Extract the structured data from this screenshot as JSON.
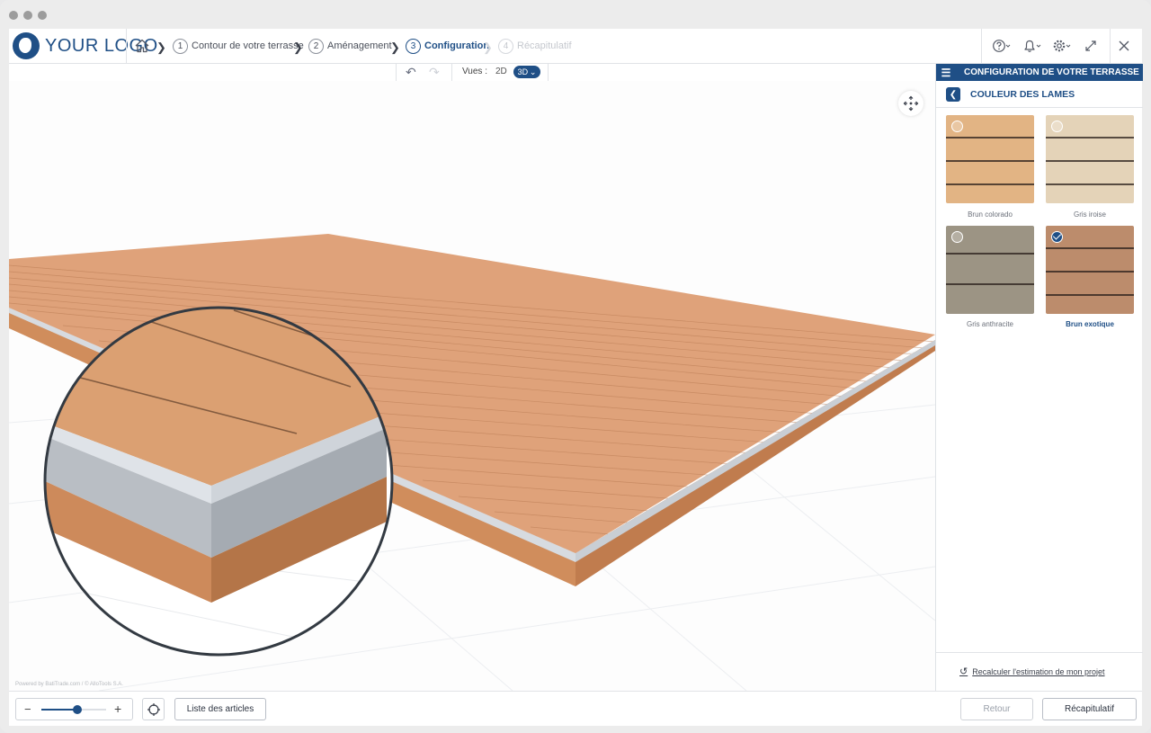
{
  "header": {
    "logo_text": "YOUR LOGO",
    "steps": [
      {
        "num": "1",
        "label": "Contour de votre terrasse",
        "state": "done"
      },
      {
        "num": "2",
        "label": "Aménagement",
        "state": "done"
      },
      {
        "num": "3",
        "label": "Configuration",
        "state": "active"
      },
      {
        "num": "4",
        "label": "Récapitulatif",
        "state": "disabled"
      }
    ]
  },
  "toolbar": {
    "views_label": "Vues :",
    "view_2d": "2D",
    "view_3d": "3D"
  },
  "viewport": {
    "powered_by": "Powered by BatiTrade.com / © AlloTools S.A."
  },
  "panel": {
    "header_title": "CONFIGURATION DE VOTRE TERRASSE",
    "section_title": "COULEUR DES LAMES",
    "swatches": [
      {
        "label": "Brun colorado",
        "color": "#e2b484",
        "selected": false
      },
      {
        "label": "Gris iroise",
        "color": "#e4d3b8",
        "selected": false
      },
      {
        "label": "Gris anthracite",
        "color": "#9c9484",
        "selected": false
      },
      {
        "label": "Brun exotique",
        "color": "#bc8c6c",
        "selected": true
      }
    ],
    "recalc_label": "Recalculer l'estimation de mon projet"
  },
  "footer": {
    "zoom_level": 0.55,
    "list_button": "Liste des articles",
    "back_button": "Retour",
    "summary_button": "Récapitulatif"
  },
  "colors": {
    "brand": "#1f4f86",
    "deck": "#dfa27a"
  }
}
